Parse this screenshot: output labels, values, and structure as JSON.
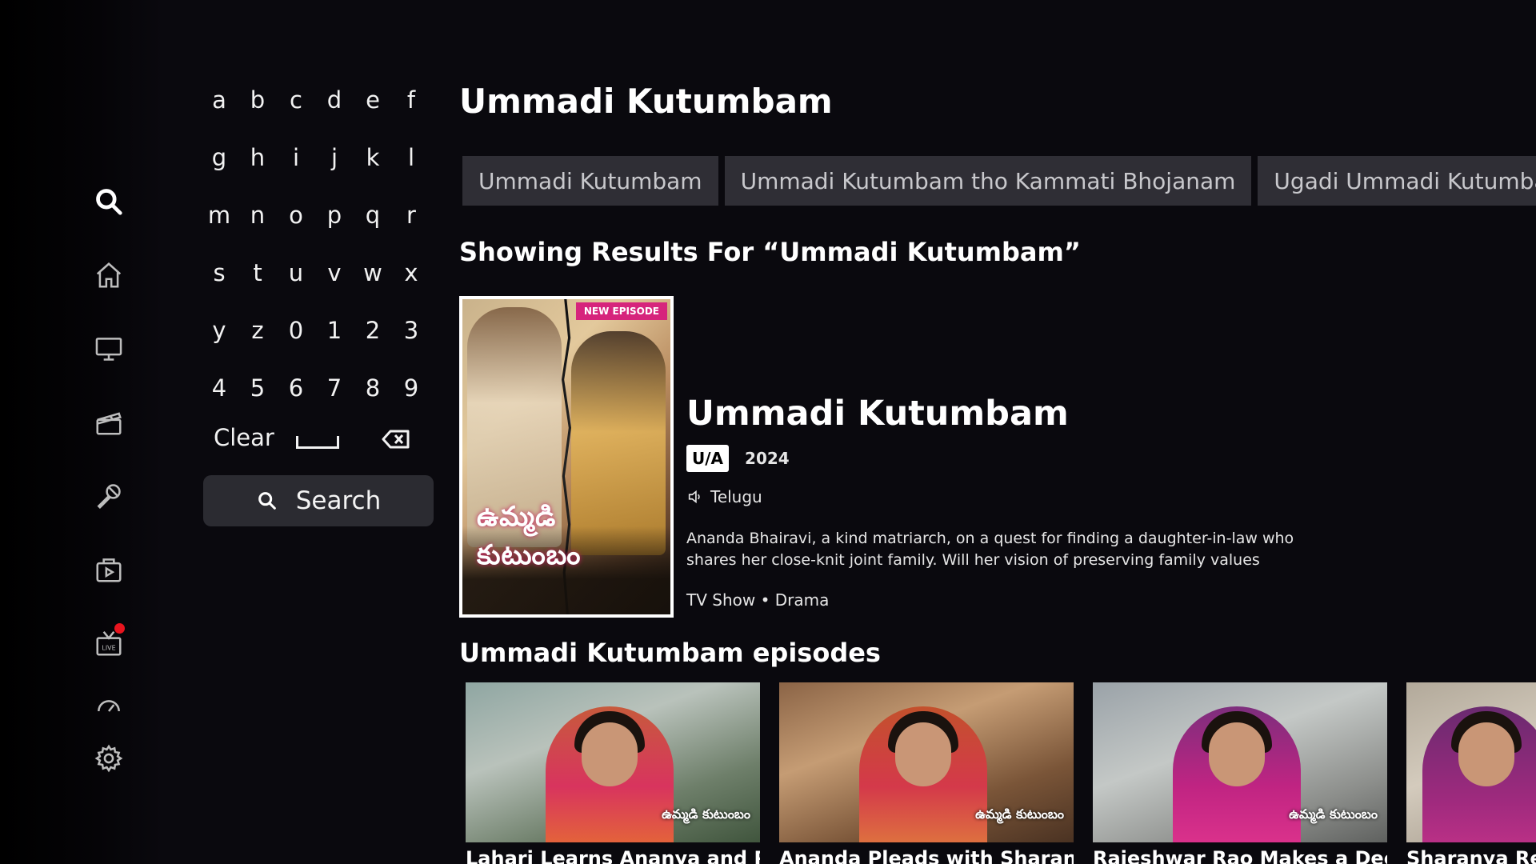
{
  "nav": {
    "items": [
      {
        "name": "search",
        "active": true
      },
      {
        "name": "home"
      },
      {
        "name": "tv-shows"
      },
      {
        "name": "movies"
      },
      {
        "name": "music"
      },
      {
        "name": "premium"
      },
      {
        "name": "live",
        "badge_label": "LIVE"
      },
      {
        "name": "gauge"
      },
      {
        "name": "settings"
      }
    ]
  },
  "keyboard": {
    "keys": [
      "a",
      "b",
      "c",
      "d",
      "e",
      "f",
      "g",
      "h",
      "i",
      "j",
      "k",
      "l",
      "m",
      "n",
      "o",
      "p",
      "q",
      "r",
      "s",
      "t",
      "u",
      "v",
      "w",
      "x",
      "y",
      "z",
      "0",
      "1",
      "2",
      "3",
      "4",
      "5",
      "6",
      "7",
      "8",
      "9"
    ],
    "clear_label": "Clear",
    "search_label": "Search"
  },
  "query": "Ummadi Kutumbam",
  "suggestions": [
    "Ummadi Kutumbam",
    "Ummadi Kutumbam tho Kammati Bhojanam",
    "Ugadi Ummadi Kutumbam"
  ],
  "results_heading": "Showing Results For “Ummadi Kutumbam”",
  "result": {
    "badge": "NEW EPISODE",
    "poster_logo": "ఉమ్మడి కుటుంబం",
    "title": "Ummadi Kutumbam",
    "rating": "U/A",
    "year": "2024",
    "language": "Telugu",
    "description": "Ananda Bhairavi, a kind matriarch, on a quest for finding a daughter-in-law who shares her close-knit joint family. Will her vision of preserving family values prevail?",
    "genres": "TV Show • Drama"
  },
  "episodes_heading": "Ummadi Kutumbam episodes",
  "episodes": [
    {
      "title": "Lahari Learns Ananya and Pra",
      "logo": "ఉమ్మడి కుటుంబం"
    },
    {
      "title": "Ananda Pleads with Sharanya",
      "logo": "ఉమ్మడి కుటుంబం"
    },
    {
      "title": "Rajeshwar Rao Makes a Decis",
      "logo": "ఉమ్మడి కుటుంబం"
    },
    {
      "title": "Sharanya Refu",
      "logo": ""
    }
  ],
  "colors": {
    "background": "#0a090e",
    "chip": "#2f2e35",
    "badge": "#d6247c",
    "live_dot": "#e8141e"
  }
}
